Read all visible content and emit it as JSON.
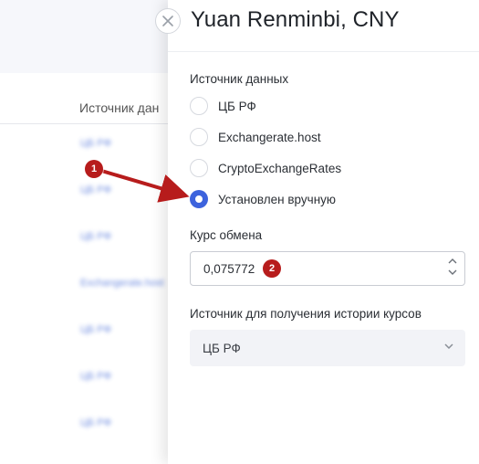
{
  "background": {
    "column_header": "Источник дан",
    "cells": [
      "ЦБ РФ",
      "ЦБ РФ",
      "ЦБ РФ",
      "Exchangerate.host",
      "ЦБ РФ",
      "ЦБ РФ",
      "ЦБ РФ"
    ]
  },
  "drawer": {
    "title": "Yuan Renminbi, CNY",
    "data_source_label": "Источник данных",
    "data_source_options": [
      {
        "label": "ЦБ РФ",
        "checked": false
      },
      {
        "label": "Exchangerate.host",
        "checked": false
      },
      {
        "label": "CryptoExchangeRates",
        "checked": false
      },
      {
        "label": "Установлен вручную",
        "checked": true
      }
    ],
    "rate_label": "Курс обмена",
    "rate_value": "0,075772",
    "history_source_label": "Источник для получения истории курсов",
    "history_source_value": "ЦБ РФ"
  },
  "annotations": {
    "badge_1": "1",
    "badge_2": "2",
    "color": "#b71c1c"
  },
  "colors": {
    "accent": "#3d63dd",
    "link": "#4a6fd8"
  }
}
